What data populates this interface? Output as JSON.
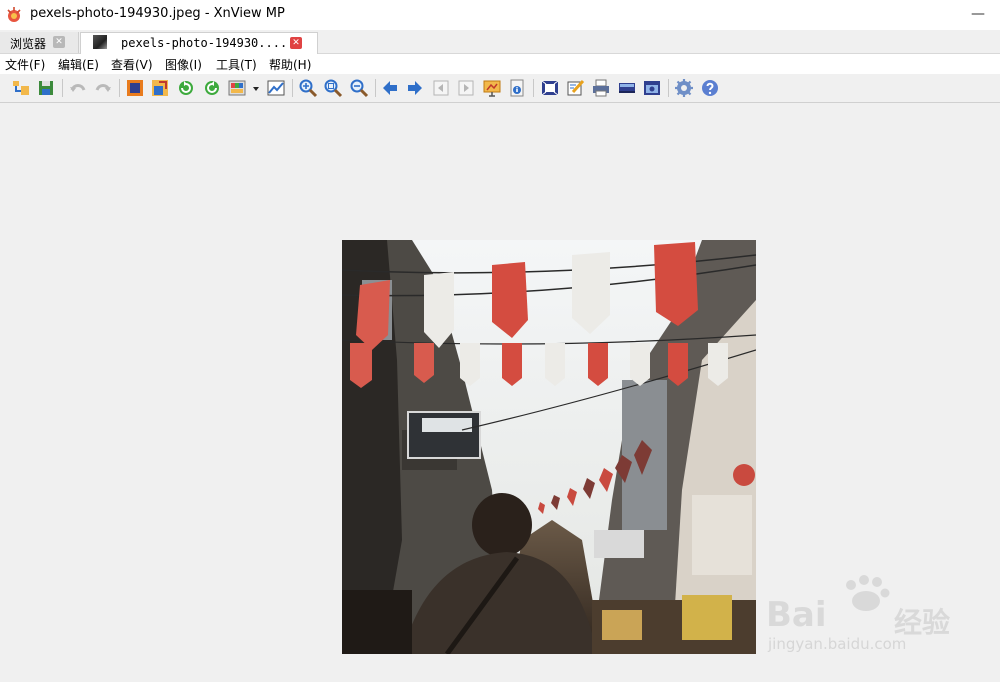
{
  "window": {
    "title": "pexels-photo-194930.jpeg - XnView MP",
    "minimize_glyph": "—"
  },
  "tabs": [
    {
      "label": "浏览器",
      "close_glyph": "✕"
    },
    {
      "label": "pexels-photo-194930....",
      "close_glyph": "✕"
    }
  ],
  "menu": [
    "文件(F)",
    "编辑(E)",
    "查看(V)",
    "图像(I)",
    "工具(T)",
    "帮助(H)"
  ],
  "toolbar_icons": [
    "browser-icon",
    "save-icon",
    "undo-icon",
    "redo-icon",
    "crop-icon",
    "resize-icon",
    "rotate-left-icon",
    "rotate-right-icon",
    "color-adjust-icon",
    "dropdown-arrow-icon",
    "levels-icon",
    "zoom-in-icon",
    "zoom-fit-icon",
    "zoom-out-icon",
    "previous-icon",
    "next-icon",
    "first-page-icon",
    "last-page-icon",
    "slideshow-icon",
    "info-icon",
    "fullscreen-icon",
    "edit-icon",
    "print-icon",
    "scan-icon",
    "capture-icon",
    "settings-icon",
    "help-icon"
  ],
  "image": {
    "filename": "pexels-photo-194930.jpeg"
  },
  "watermark": {
    "brand": "Bai",
    "brand_cn": "经验",
    "url": "jingyan.baidu.com"
  },
  "colors": {
    "accent_red": "#e8553f",
    "tab_close_red": "#e04343",
    "icon_blue": "#2f6fc9"
  }
}
